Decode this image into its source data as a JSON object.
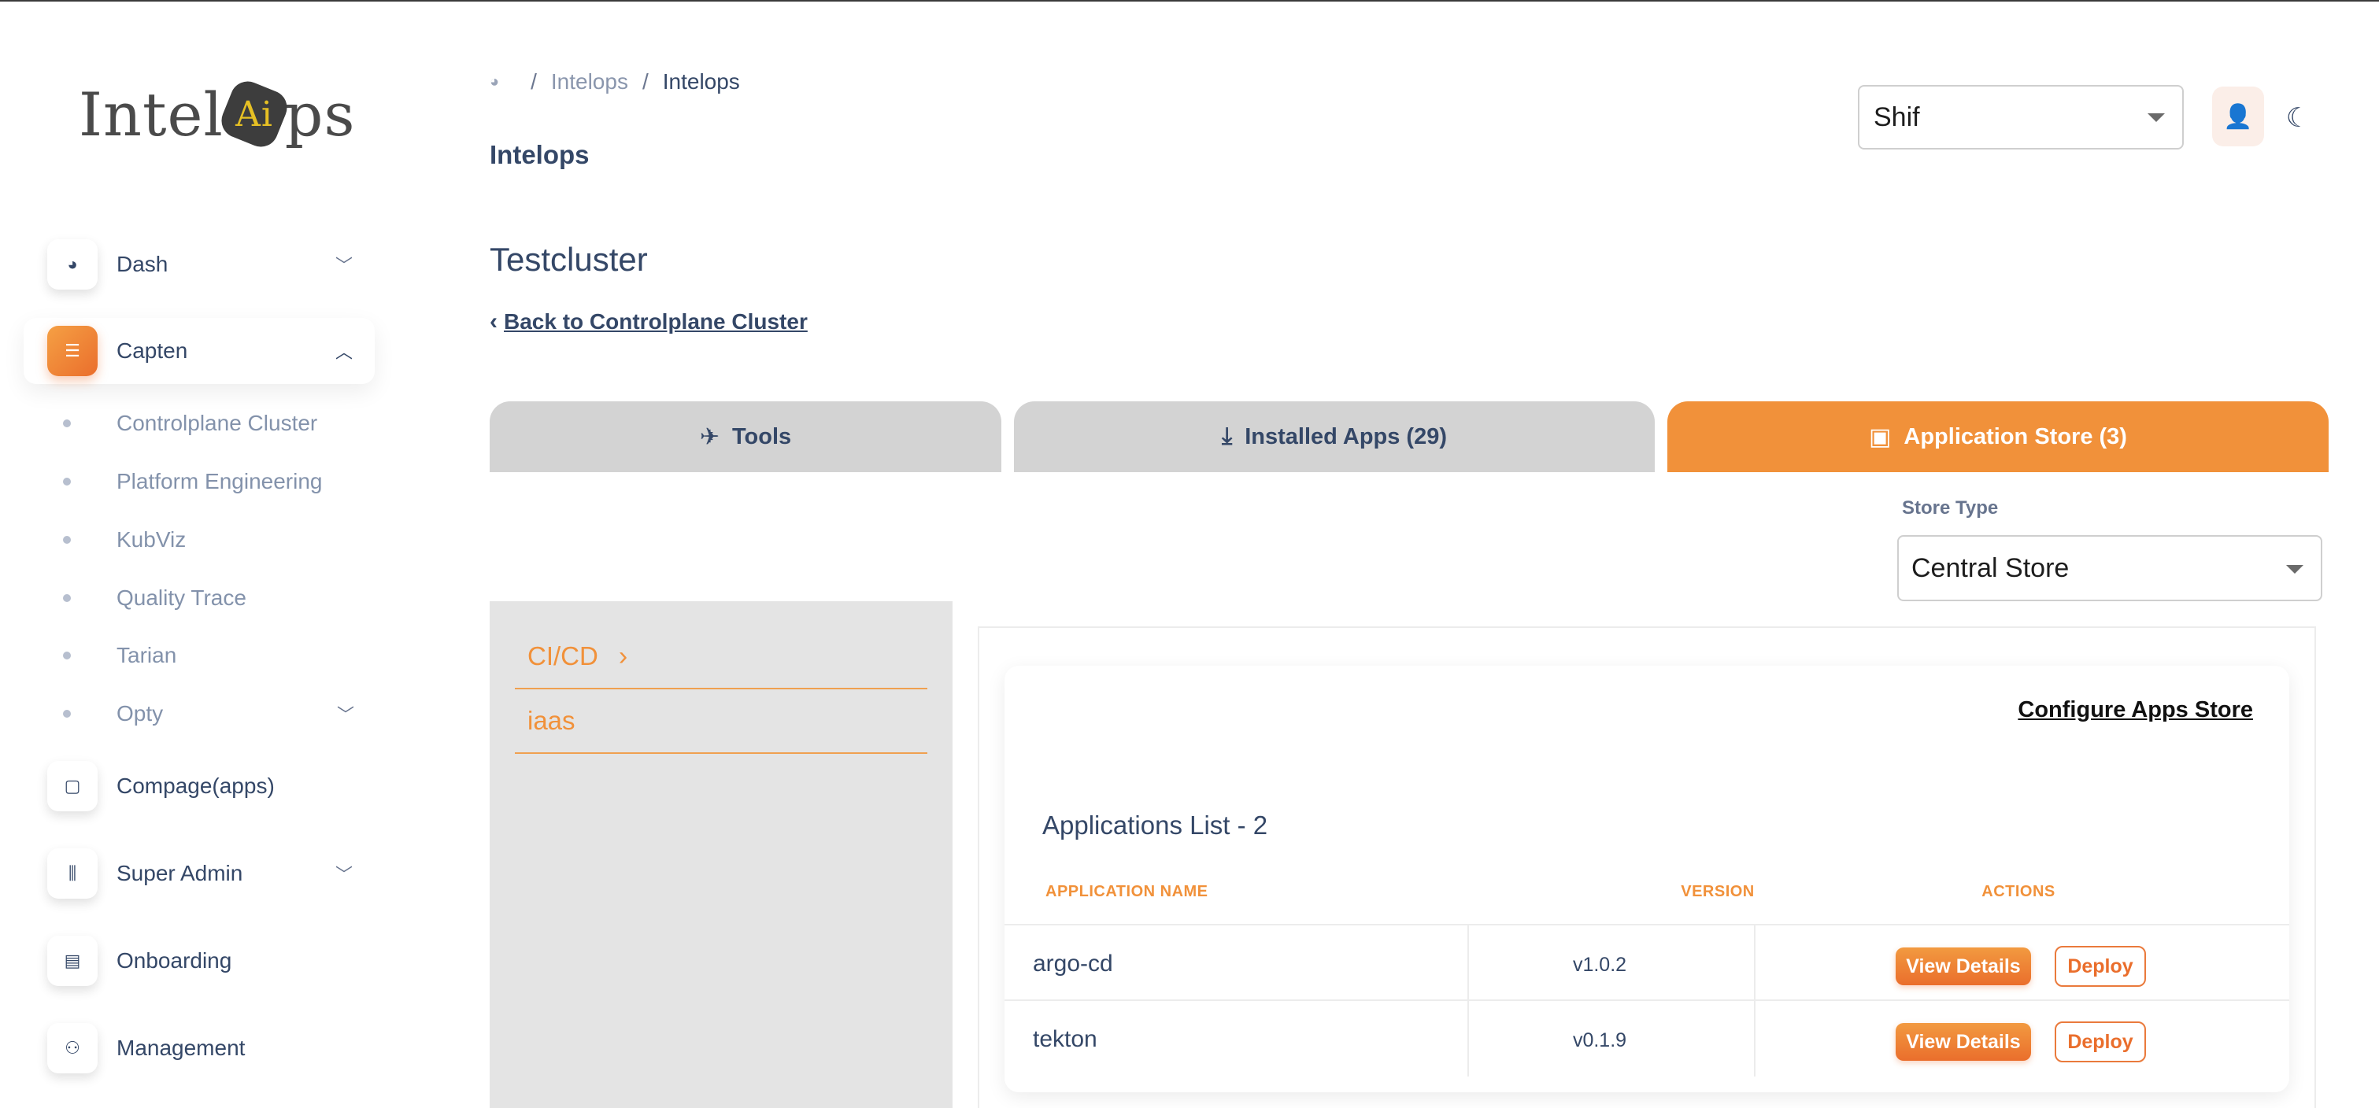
{
  "logo": {
    "text_prefix": "Intel",
    "text_mid": "Ai",
    "text_suffix": "ps"
  },
  "sidebar": {
    "items": [
      {
        "label": "Dash",
        "icon": "pie-chart-icon",
        "expanded": false
      },
      {
        "label": "Capten",
        "icon": "server-icon",
        "expanded": true,
        "active": true
      },
      {
        "label": "Compage(apps)",
        "icon": "square-icon"
      },
      {
        "label": "Super Admin",
        "icon": "sliders-icon",
        "expanded": false
      },
      {
        "label": "Onboarding",
        "icon": "clipboard-icon"
      },
      {
        "label": "Management",
        "icon": "users-icon"
      }
    ],
    "subitems": [
      {
        "label": "Controlplane Cluster"
      },
      {
        "label": "Platform Engineering"
      },
      {
        "label": "KubViz"
      },
      {
        "label": "Quality Trace"
      },
      {
        "label": "Tarian"
      },
      {
        "label": "Opty"
      }
    ]
  },
  "breadcrumb": {
    "items": [
      "Intelops",
      "Intelops"
    ],
    "separator": "/"
  },
  "header": {
    "page_title": "Intelops",
    "user_select_value": "Shif"
  },
  "main": {
    "cluster_title": "Testcluster",
    "back_link": "Back to Controlplane Cluster",
    "tabs": [
      {
        "label": "Tools",
        "icon": "rocket-icon"
      },
      {
        "label": "Installed Apps (29)",
        "icon": "download-icon"
      },
      {
        "label": "Application Store (3)",
        "icon": "toolbox-icon",
        "active": true
      }
    ],
    "store_type": {
      "label": "Store Type",
      "value": "Central Store"
    },
    "categories": [
      {
        "label": "CI/CD",
        "selected": true
      },
      {
        "label": "iaas"
      }
    ],
    "list": {
      "configure_link": "Configure Apps Store",
      "title": "Applications List - 2",
      "columns": [
        "APPLICATION NAME",
        "VERSION",
        "ACTIONS"
      ],
      "rows": [
        {
          "name": "argo-cd",
          "version": "v1.0.2",
          "view_label": "View Details",
          "deploy_label": "Deploy"
        },
        {
          "name": "tekton",
          "version": "v0.1.9",
          "view_label": "View Details",
          "deploy_label": "Deploy"
        }
      ]
    }
  },
  "colors": {
    "accent": "#f1913a",
    "text": "#344767",
    "muted": "#8392ab",
    "panel": "#e4e4e4",
    "tab_inactive": "#d3d3d3"
  }
}
